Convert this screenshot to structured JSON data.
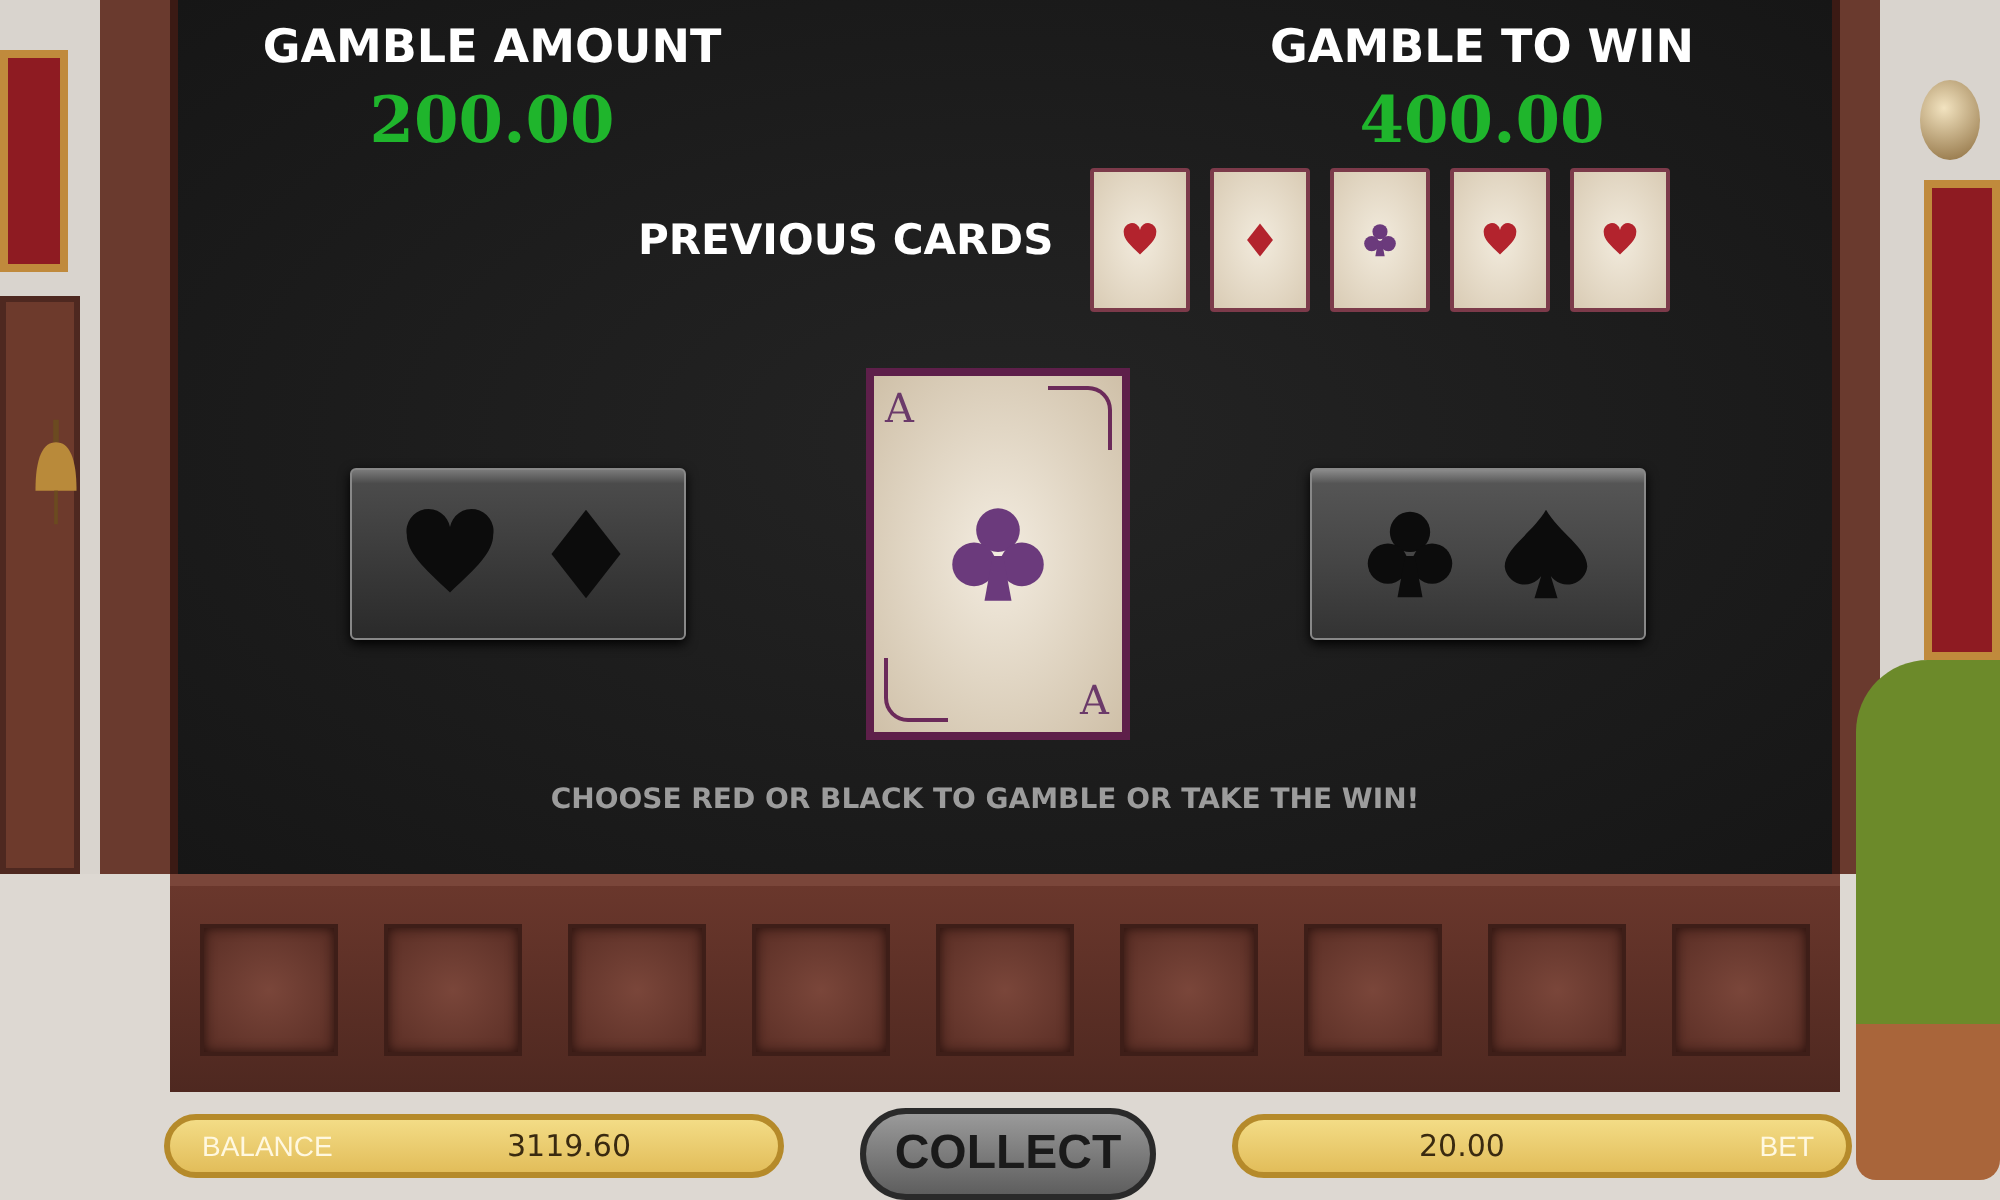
{
  "gamble_amount": {
    "label": "GAMBLE AMOUNT",
    "value": "200.00"
  },
  "gamble_to_win": {
    "label": "GAMBLE TO WIN",
    "value": "400.00"
  },
  "previous_cards": {
    "label": "PREVIOUS CARDS",
    "cards": [
      {
        "kind": "heart"
      },
      {
        "kind": "diamond"
      },
      {
        "kind": "club"
      },
      {
        "kind": "heart"
      },
      {
        "kind": "heart"
      }
    ]
  },
  "choices": [
    {
      "icons": [
        {
          "kind": "heart"
        },
        {
          "kind": "diamond"
        }
      ]
    },
    {
      "icons": [
        {
          "kind": "club"
        },
        {
          "kind": "spade"
        }
      ]
    }
  ],
  "current_card": {
    "rank_top": "A",
    "rank_bottom": "A",
    "kind": "club"
  },
  "message": "CHOOSE RED OR BLACK TO GAMBLE OR TAKE THE WIN!",
  "status_bar": {
    "balance_label": "BALANCE",
    "balance": "3119.60",
    "collect": "COLLECT",
    "bet": "20.00",
    "bet_label": "BET"
  }
}
